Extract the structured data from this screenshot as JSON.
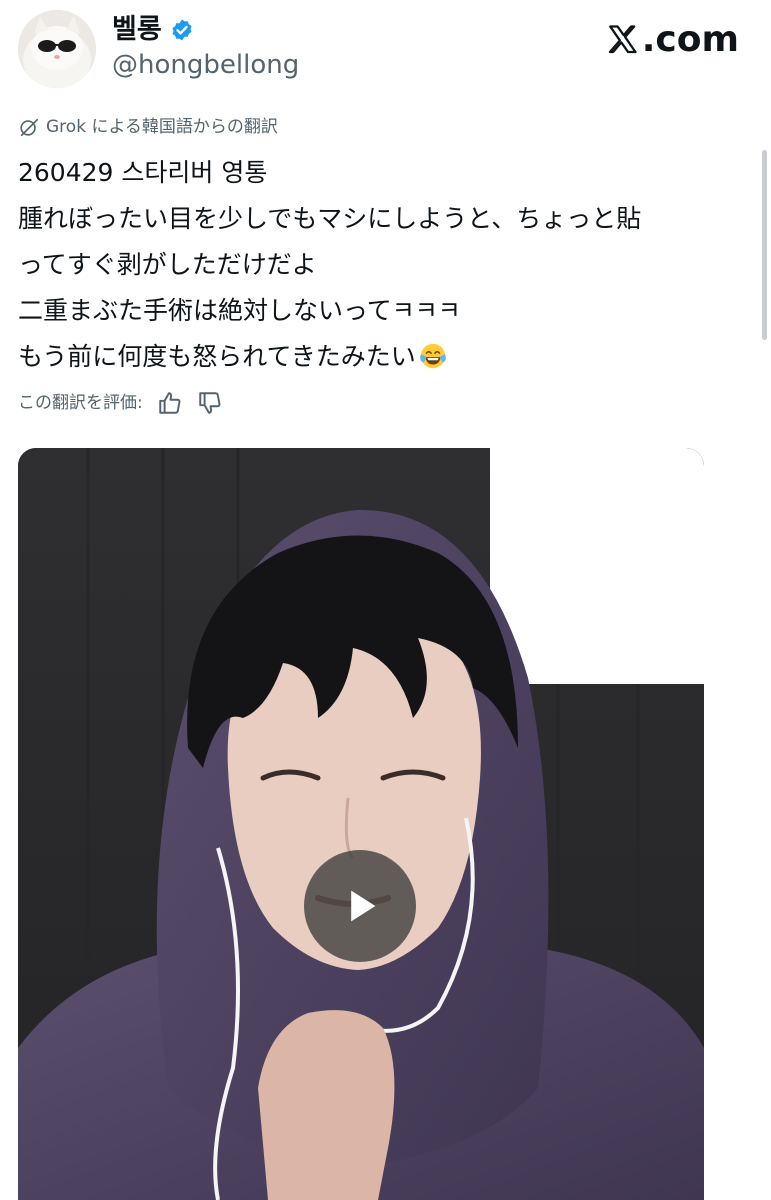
{
  "author": {
    "display_name": "벨롱",
    "handle": "@hongbellong",
    "verified_color": "#1d9bf0"
  },
  "brand": {
    "logo_text": ".com",
    "logo_icon": "x-logo-icon"
  },
  "translation": {
    "label": "Grok による韓国語からの翻訳",
    "icon": "grok-icon"
  },
  "tweet": {
    "lines": [
      "260429 스타리버 영통",
      "腫れぼったい目を少しでもマシにしようと、ちょっと貼",
      "ってすぐ剥がしただけだよ",
      "二重まぶた手術は絶対しないってㅋㅋㅋ",
      "もう前に何度も怒られてきたみたい"
    ],
    "trailing_emoji": "face-with-tears-of-joy-emoji"
  },
  "rating": {
    "label": "この翻訳を評価:",
    "icons": [
      "thumbs-up-icon",
      "thumbs-down-icon"
    ]
  },
  "media": {
    "type": "video",
    "play_icon": "play-icon"
  }
}
